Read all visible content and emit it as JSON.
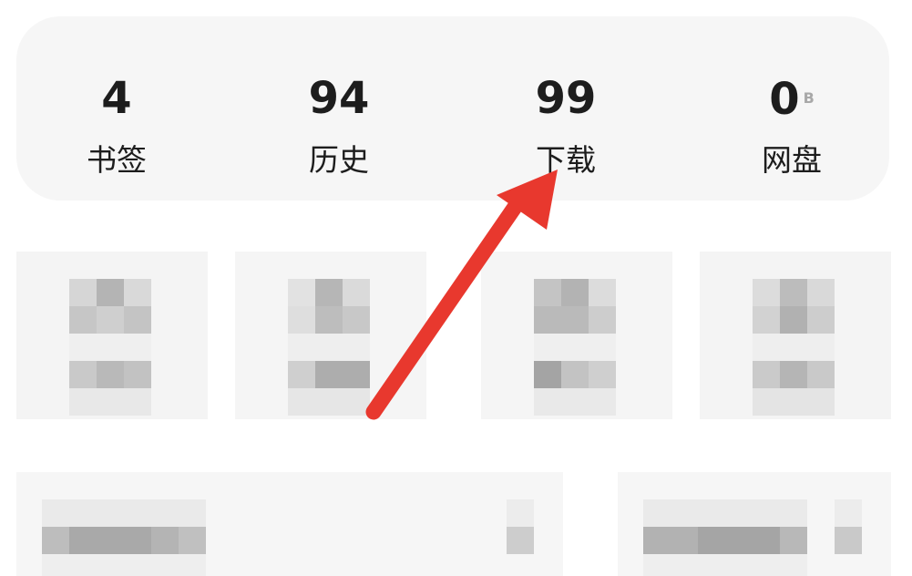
{
  "stats": [
    {
      "value": "4",
      "unit": "",
      "label": "书签"
    },
    {
      "value": "94",
      "unit": "",
      "label": "历史"
    },
    {
      "value": "99",
      "unit": "",
      "label": "下载"
    },
    {
      "value": "0",
      "unit": "B",
      "label": "网盘"
    }
  ],
  "colors": {
    "card_bg": "#f6f6f6",
    "text": "#1d1d1d",
    "unit": "#a8a8a8",
    "arrow": "#e8382e"
  },
  "annotations": {
    "arrow": "red-arrow-pointing-to-download"
  }
}
